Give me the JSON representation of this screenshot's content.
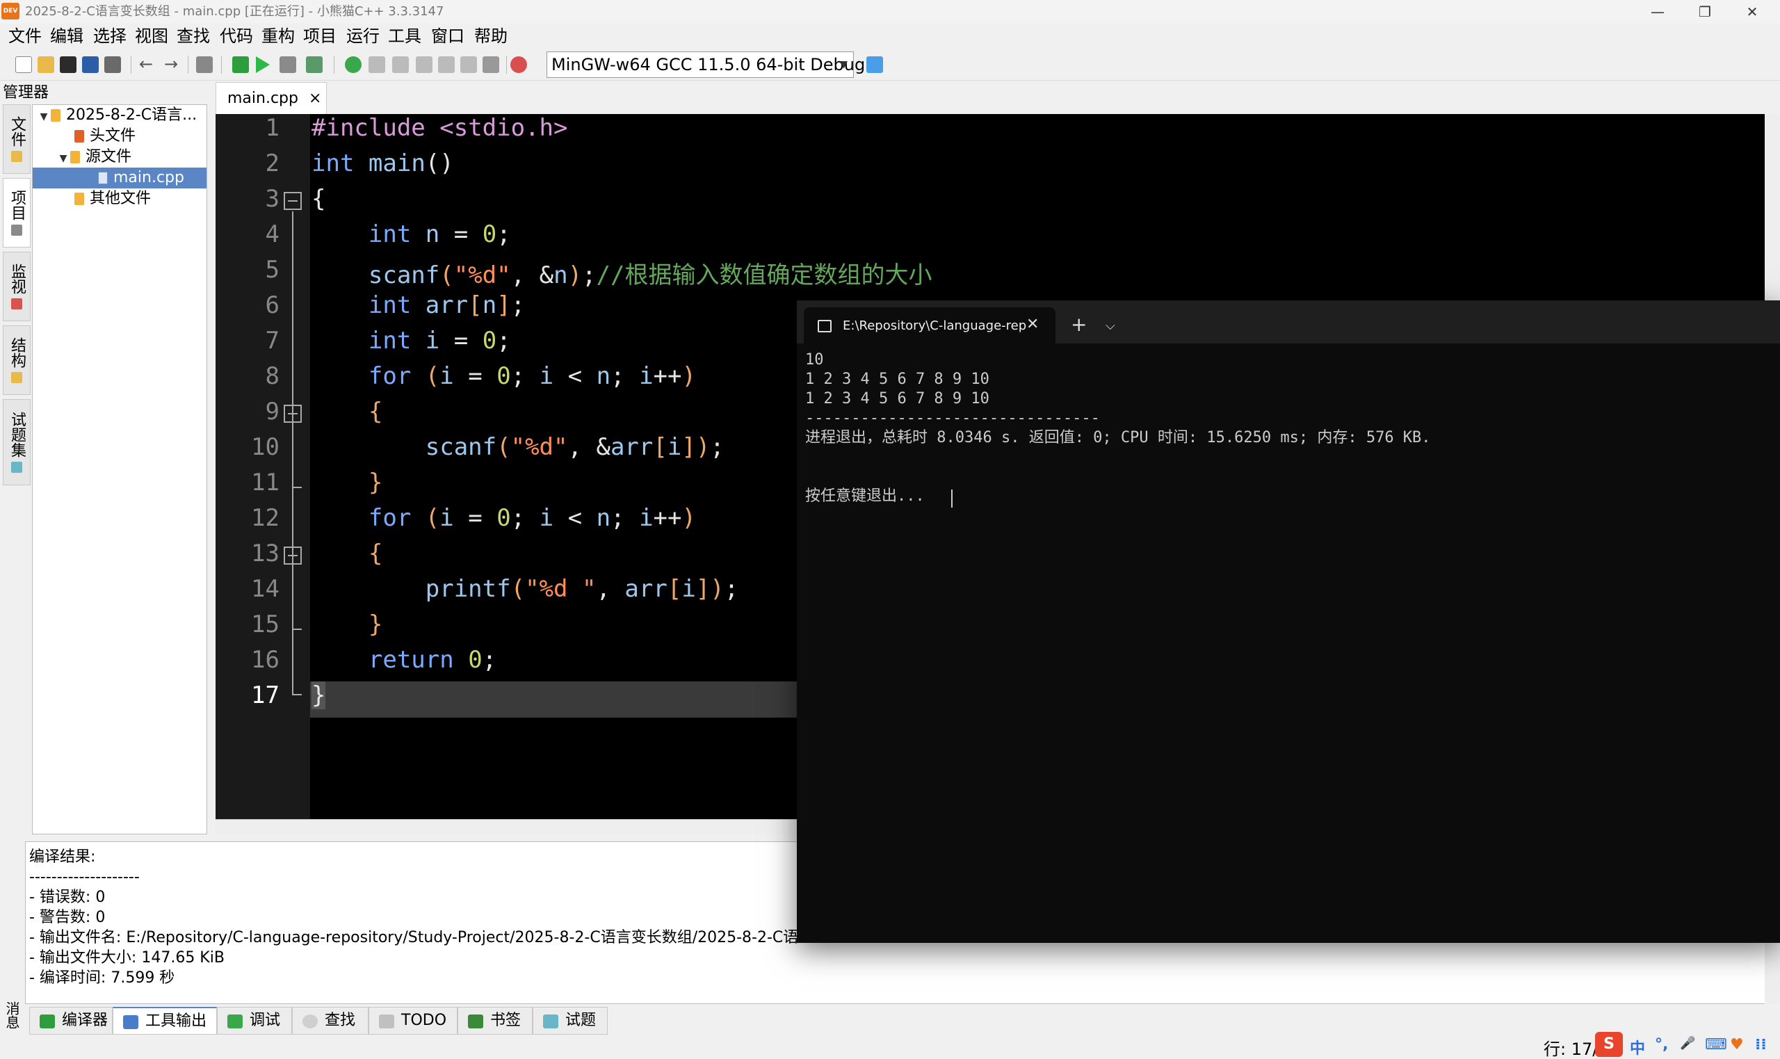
{
  "window": {
    "title": "2025-8-2-C语言变长数组 - main.cpp [正在运行] - 小熊猫C++ 3.3.3147",
    "logo_text": "DEV",
    "minimize": "—",
    "restore": "❐",
    "close": "✕"
  },
  "menu": [
    "文件",
    "编辑",
    "选择",
    "视图",
    "查找",
    "代码",
    "重构",
    "项目",
    "运行",
    "工具",
    "窗口",
    "帮助"
  ],
  "toolbar": {
    "compiler": "MinGW-w64 GCC 11.5.0 64-bit Debug",
    "back_arrow": "←",
    "forward_arrow": "→"
  },
  "manager": {
    "title": "管理器",
    "side_tabs": [
      "文件",
      "项目",
      "监视",
      "结构",
      "试题集"
    ],
    "tree": {
      "project": "2025-8-2-C语言...",
      "headers": "头文件",
      "sources": "源文件",
      "main": "main.cpp",
      "others": "其他文件"
    }
  },
  "editor": {
    "tab_label": "main.cpp",
    "tab_close": "×",
    "line_numbers": [
      "1",
      "2",
      "3",
      "4",
      "5",
      "6",
      "7",
      "8",
      "9",
      "10",
      "11",
      "12",
      "13",
      "14",
      "15",
      "16",
      "17"
    ],
    "current_line": "17"
  },
  "colors": {
    "keyword": "#79aaff",
    "string": "#ff8f5a",
    "number": "#c7d96b",
    "preprocessor": "#d99bd9",
    "comment": "#64a85c",
    "selection": "#5b86c5"
  },
  "terminal": {
    "tab_title": "E:\\Repository\\C-language-rep",
    "tab_close": "✕",
    "new_tab": "+",
    "dropdown": "⌵",
    "lines": [
      "10",
      "1 2 3 4 5 6 7 8 9 10",
      "1 2 3 4 5 6 7 8 9 10",
      "--------------------------------",
      "进程退出，总耗时 8.0346 s. 返回值: 0; CPU 时间: 15.6250 ms; 内存: 576 KB.",
      "",
      "按任意键退出..."
    ]
  },
  "messages": {
    "side_label": "消息",
    "lines": [
      "编译结果:",
      "--------------------",
      "- 错误数: 0",
      "- 警告数: 0",
      "- 输出文件名: E:/Repository/C-language-repository/Study-Project/2025-8-2-C语言变长数组/2025-8-2-C语",
      "- 输出文件大小: 147.65 KiB",
      "- 编译时间: 7.599 秒"
    ],
    "tabs": [
      "编译器",
      "工具输出",
      "调试",
      "查找",
      "TODO",
      "书签",
      "试题"
    ],
    "active_tab": "工具输出"
  },
  "status": {
    "line": "行: 17/",
    "ime": [
      "S",
      "中",
      "°,",
      "🎤",
      "⌨",
      "♥",
      "⁞⁞"
    ]
  }
}
